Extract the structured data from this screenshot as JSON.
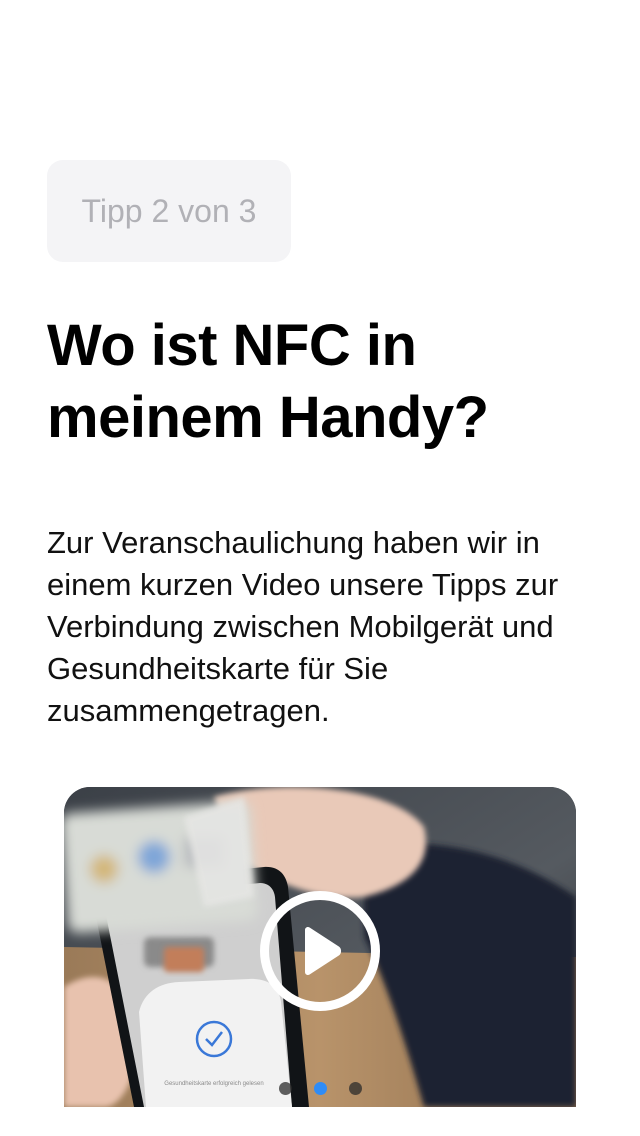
{
  "tip": {
    "counter": "Tipp 2 von 3"
  },
  "heading": {
    "title": "Wo ist NFC in meinem Handy?"
  },
  "content": {
    "description": "Zur Veranschaulichung haben wir in einem kurzen Video unsere Tipps zur Verbindung zwischen Mobilgerät und Gesundheitskarte für Sie zusammengetragen."
  },
  "video": {
    "play_icon": "play-icon",
    "overlay_text": "Gesundheitskarte erfolgreich gelesen"
  },
  "pager": {
    "count": 3,
    "active_index": 1
  },
  "colors": {
    "accent": "#2f8cf6",
    "badge_background": "#f4f4f6",
    "badge_text": "#b1b1b6"
  }
}
